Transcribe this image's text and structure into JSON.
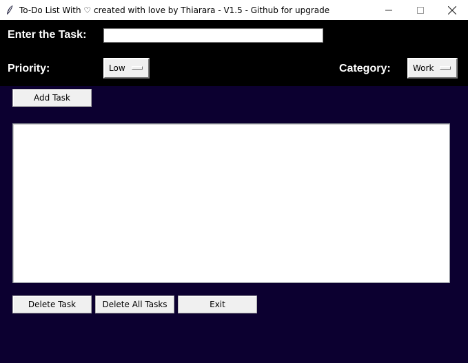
{
  "window": {
    "title": "To-Do List With ♡ created with love by Thiarara - V1.5 - Github for upgrade",
    "icons": [
      "feather-icon",
      "minimize-icon",
      "maximize-icon",
      "close-icon"
    ]
  },
  "form": {
    "task_label": "Enter the Task:",
    "task_value": "",
    "priority_label": "Priority:",
    "priority_value": "Low",
    "category_label": "Category:",
    "category_value": "Work"
  },
  "buttons": {
    "add": "Add Task",
    "delete": "Delete Task",
    "delete_all": "Delete All Tasks",
    "exit": "Exit"
  },
  "tasks": [],
  "colors": {
    "background": "#0c0030",
    "top_panel": "#000000",
    "button_face": "#f0f0f0"
  }
}
